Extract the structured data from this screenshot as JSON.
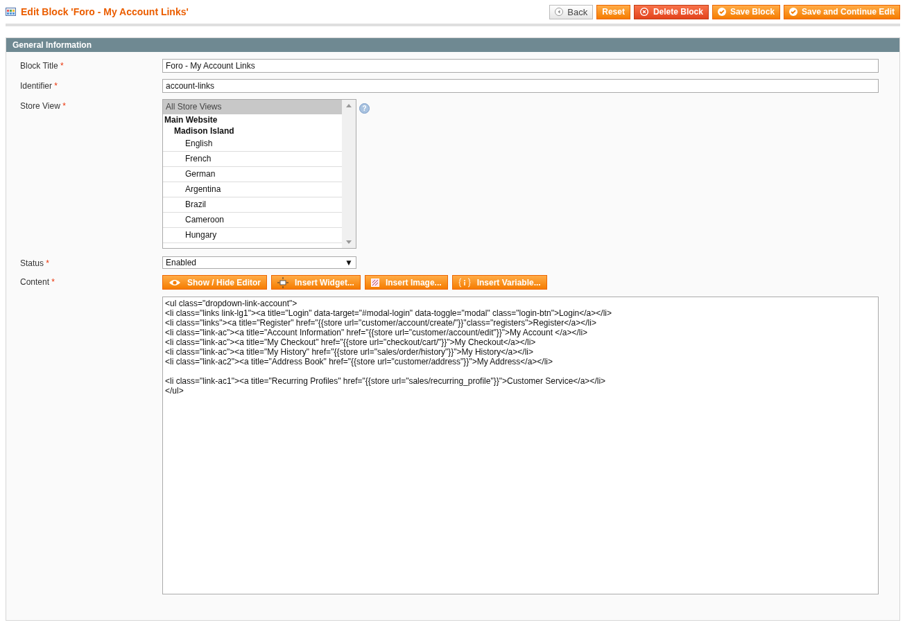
{
  "header": {
    "title": "Edit Block 'Foro - My Account Links'"
  },
  "buttons": [
    {
      "label": "Back",
      "kind": "back"
    },
    {
      "label": "Reset",
      "kind": "plain"
    },
    {
      "label": "Delete Block",
      "kind": "delete"
    },
    {
      "label": "Save Block",
      "kind": "save"
    },
    {
      "label": "Save and Continue Edit",
      "kind": "save"
    }
  ],
  "section": {
    "title": "General Information"
  },
  "fields": {
    "block_title": {
      "label": "Block Title",
      "required_mark": "*",
      "value": "Foro - My Account Links"
    },
    "identifier": {
      "label": "Identifier",
      "required_mark": "*",
      "value": "account-links"
    },
    "store_view": {
      "label": "Store View",
      "required_mark": "*",
      "help": "?",
      "options": [
        {
          "label": "All Store Views",
          "kind": "option",
          "selected": true
        },
        {
          "label": "Main Website",
          "kind": "group",
          "children": [
            {
              "label": "Madison Island",
              "kind": "group",
              "children": [
                {
                  "label": "English",
                  "kind": "option",
                  "selected": false
                },
                {
                  "label": "French",
                  "kind": "option",
                  "selected": false
                },
                {
                  "label": "German",
                  "kind": "option",
                  "selected": false
                },
                {
                  "label": "Argentina",
                  "kind": "option",
                  "selected": false
                },
                {
                  "label": "Brazil",
                  "kind": "option",
                  "selected": false
                },
                {
                  "label": "Cameroon",
                  "kind": "option",
                  "selected": false
                },
                {
                  "label": "Hungary",
                  "kind": "option",
                  "selected": false
                }
              ]
            }
          ]
        }
      ]
    },
    "status": {
      "label": "Status",
      "required_mark": "*",
      "value": "Enabled",
      "arrow": "▼"
    },
    "content": {
      "label": "Content",
      "required_mark": "*",
      "editor_buttons": [
        {
          "label": "Show / Hide Editor",
          "kind": "eye"
        },
        {
          "label": "Insert Widget...",
          "kind": "widget"
        },
        {
          "label": "Insert Image...",
          "kind": "image"
        },
        {
          "label": "Insert Variable...",
          "kind": "variable"
        }
      ],
      "blocks": [
        [
          "<ul class=\"dropdown-link-account\">",
          "<li class=\"links link-lg1\"><a title=\"Login\" data-target=\"#modal-login\" data-toggle=\"modal\" class=\"login-btn\">Login</a></li>",
          "<li class=\"links\"><a title=\"Register\" href=\"{{store url=\"customer/account/create/\"}}\"class=\"registers\">Register</a></li>",
          "<li class=\"link-ac\"><a title=\"Account Information\" href=\"{{store url=\"customer/account/edit\"}}\">My Account </a></li>",
          "<li class=\"link-ac\"><a title=\"My Checkout\" href=\"{{store url=\"checkout/cart/\"}}\">My Checkout</a></li>",
          "<li class=\"link-ac\"><a title=\"My History\" href=\"{{store url=\"sales/order/history\"}}\">My History</a></li>",
          "<li class=\"link-ac2\"><a title=\"Address Book\" href=\"{{store url=\"customer/address\"}}\">My Address</a></li>"
        ],
        [
          "<li class=\"link-ac1\"><a title=\"Recurring Profiles\" href=\"{{store url=\"sales/recurring_profile\"}}\">Customer Service</a></li>",
          "</ul>"
        ]
      ]
    }
  }
}
